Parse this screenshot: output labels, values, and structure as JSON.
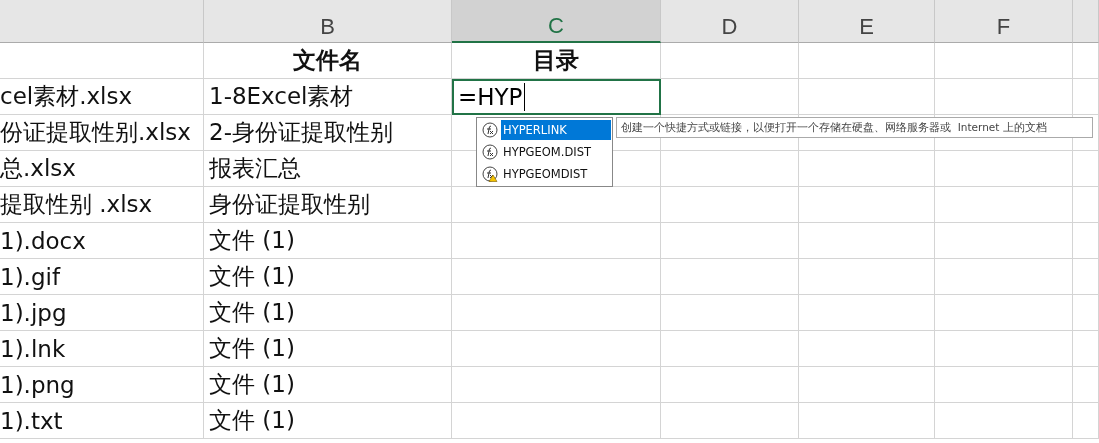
{
  "columns": [
    {
      "selected": false
    },
    {
      "label": "B",
      "selected": false
    },
    {
      "label": "C",
      "selected": true
    },
    {
      "label": "D",
      "selected": false
    },
    {
      "label": "E",
      "selected": false
    },
    {
      "label": "F",
      "selected": false
    },
    {
      "selected": false
    }
  ],
  "header_row": {
    "b": "文件名",
    "c": "目录"
  },
  "rows": [
    {
      "a": "cel素材.xlsx",
      "b": "1-8Excel素材",
      "editing": "=HYP"
    },
    {
      "a": "份证提取性别.xlsx",
      "b": "2-身份证提取性别"
    },
    {
      "a": "总.xlsx",
      "b": "报表汇总"
    },
    {
      "a": "提取性别 .xlsx",
      "b": "身份证提取性别"
    },
    {
      "a": "1).docx",
      "b": "文件 (1)"
    },
    {
      "a": "1).gif",
      "b": "文件 (1)"
    },
    {
      "a": "1).jpg",
      "b": "文件 (1)"
    },
    {
      "a": "1).lnk",
      "b": "文件 (1)"
    },
    {
      "a": "1).png",
      "b": "文件 (1)"
    },
    {
      "a": "1).txt",
      "b": "文件 (1)"
    }
  ],
  "autocomplete": {
    "items": [
      {
        "label": "HYPERLINK",
        "selected": true,
        "kind": "function"
      },
      {
        "label": "HYPGEOM.DIST",
        "selected": false,
        "kind": "function"
      },
      {
        "label": "HYPGEOMDIST",
        "selected": false,
        "kind": "legacy"
      }
    ],
    "tooltip": "创建一个快捷方式或链接，以便打开一个存储在硬盘、网络服务器或  Internet 上的文档"
  }
}
